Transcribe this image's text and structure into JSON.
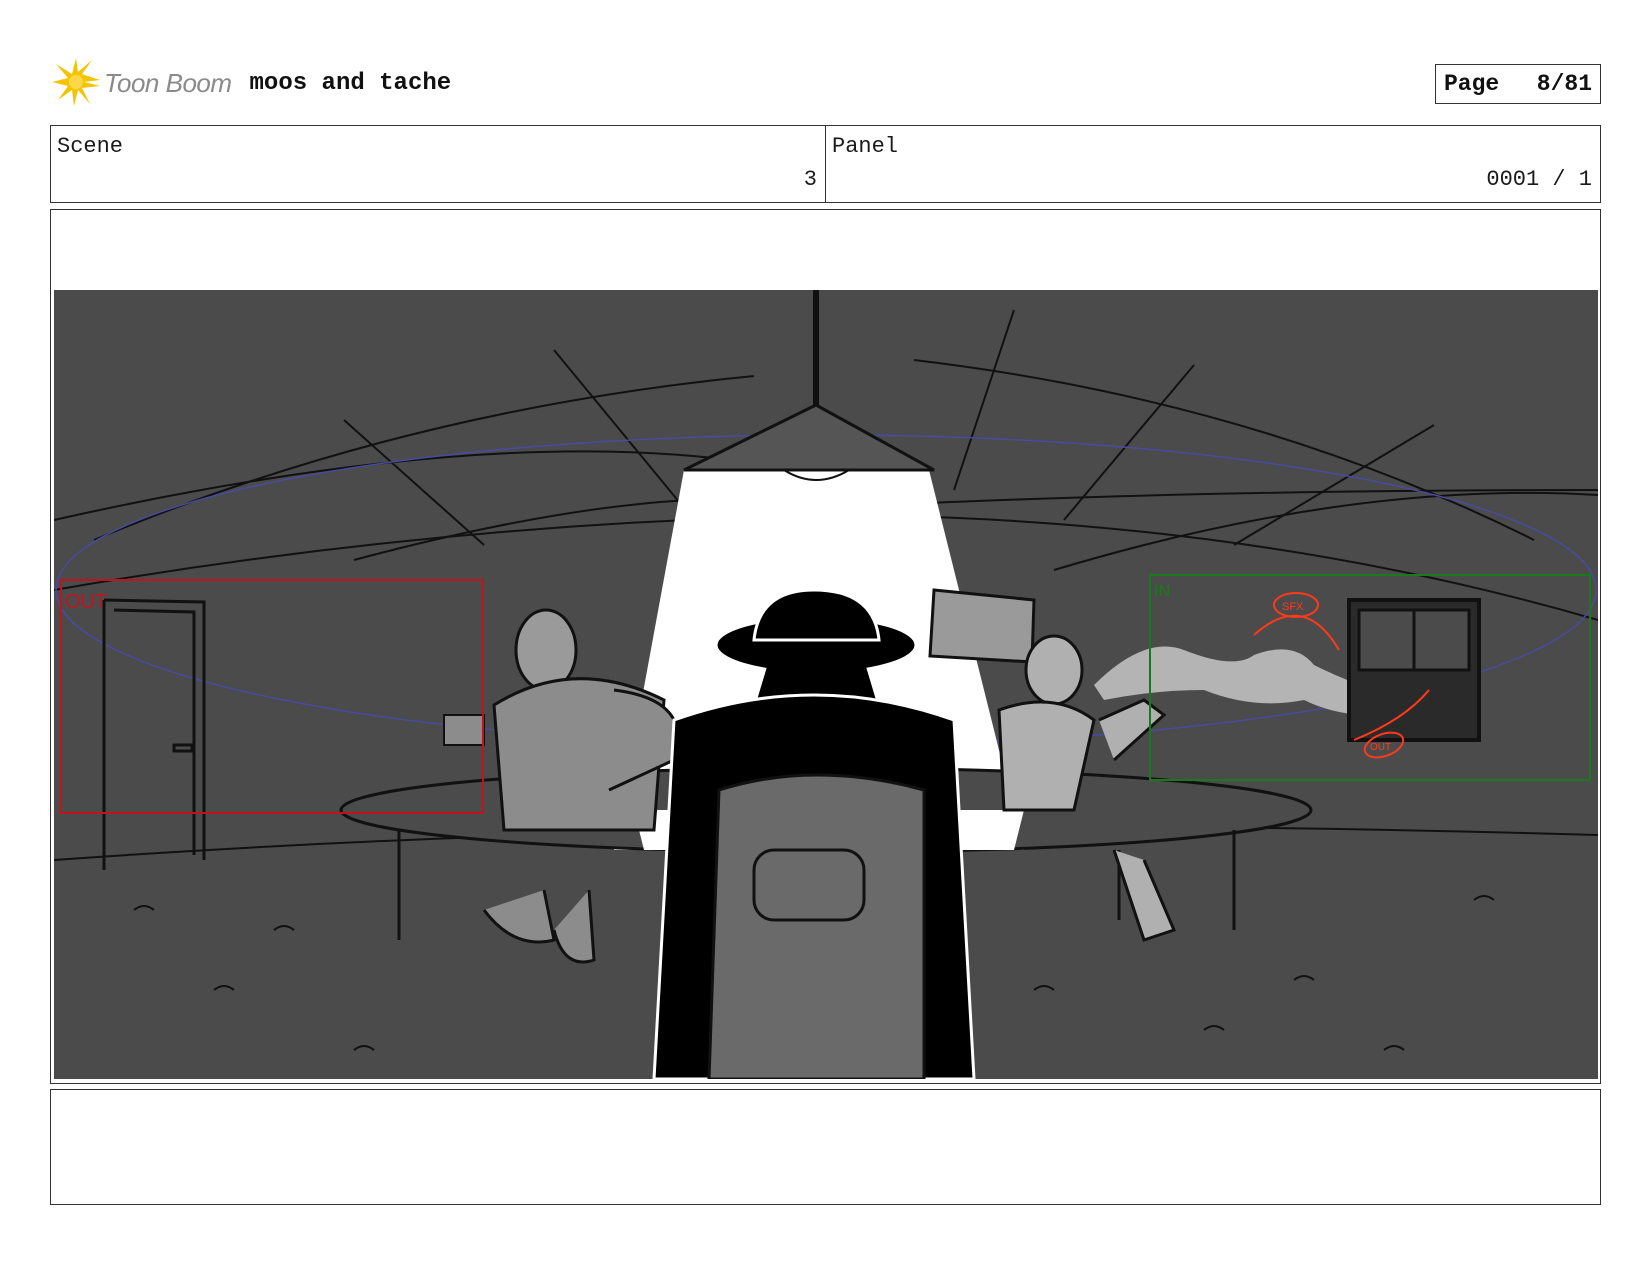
{
  "header": {
    "logo_text": "Toon Boom",
    "project_title": "moos and tache",
    "page_label": "Page",
    "page_value": "8/81"
  },
  "scene": {
    "label": "Scene",
    "value": "3"
  },
  "panel": {
    "label": "Panel",
    "value": "0001 / 1"
  },
  "drawing": {
    "background_color": "#4b4b4b",
    "annotations": {
      "out_frame_label": "OUT",
      "in_frame_label": "IN",
      "sfx_label": "SFX",
      "out_arrow_label": "OUT"
    },
    "colors": {
      "out_frame": "#c0141c",
      "in_frame": "#1a7a1a",
      "camera_path": "#4a4aa0",
      "sfx_red": "#ff3a1a",
      "light_cone": "#ffffff"
    }
  },
  "notes": {
    "text": ""
  }
}
